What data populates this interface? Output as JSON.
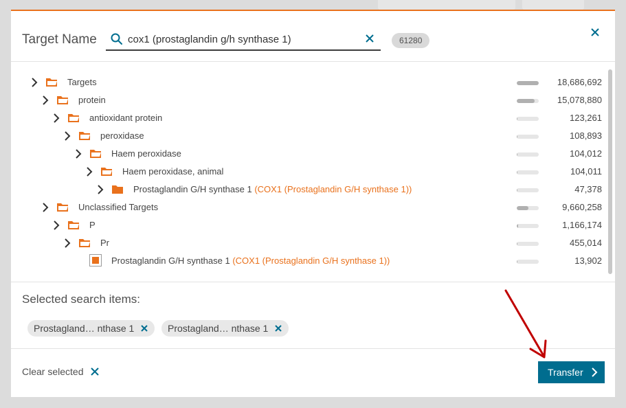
{
  "header": {
    "title": "Target Name",
    "search_value": "cox1 (prostaglandin g/h synthase 1)",
    "result_count": "61280",
    "close_icon": "close-icon",
    "search_icon": "search-icon",
    "clear_icon": "clear-search-icon"
  },
  "tree": {
    "rows": [
      {
        "label": "Targets",
        "synonym": "",
        "count": "18,686,692",
        "fraction": 1.0,
        "node": "folder-open",
        "expandable": true
      },
      {
        "label": "protein",
        "synonym": "",
        "count": "15,078,880",
        "fraction": 0.81,
        "node": "folder-open",
        "expandable": true
      },
      {
        "label": "antioxidant protein",
        "synonym": "",
        "count": "123,261",
        "fraction": 0.007,
        "node": "folder-open",
        "expandable": true
      },
      {
        "label": "peroxidase",
        "synonym": "",
        "count": "108,893",
        "fraction": 0.006,
        "node": "folder-open",
        "expandable": true
      },
      {
        "label": "Haem peroxidase",
        "synonym": "",
        "count": "104,012",
        "fraction": 0.006,
        "node": "folder-open",
        "expandable": true
      },
      {
        "label": "Haem peroxidase, animal",
        "synonym": "",
        "count": "104,011",
        "fraction": 0.006,
        "node": "folder-open",
        "expandable": true
      },
      {
        "label": "Prostaglandin G/H synthase 1 ",
        "synonym": "(COX1 (Prostaglandin G/H synthase 1))",
        "count": "47,378",
        "fraction": 0.003,
        "node": "folder-closed",
        "expandable": true
      },
      {
        "label": "Unclassified Targets",
        "synonym": "",
        "count": "9,660,258",
        "fraction": 0.52,
        "node": "folder-open",
        "expandable": true
      },
      {
        "label": "P",
        "synonym": "",
        "count": "1,166,174",
        "fraction": 0.06,
        "node": "folder-open",
        "expandable": true
      },
      {
        "label": "Pr",
        "synonym": "",
        "count": "455,014",
        "fraction": 0.025,
        "node": "folder-open",
        "expandable": true
      },
      {
        "label": "Prostaglandin G/H synthase 1 ",
        "synonym": "(COX1 (Prostaglandin G/H synthase 1))",
        "count": "13,902",
        "fraction": 0.001,
        "node": "checkbox-checked",
        "expandable": false
      }
    ]
  },
  "selected": {
    "title": "Selected search items:",
    "chips": [
      "Prostagland… nthase 1",
      "Prostagland… nthase 1"
    ]
  },
  "footer": {
    "clear_label": "Clear selected",
    "transfer_label": "Transfer"
  },
  "colors": {
    "accent": "#e9711c",
    "primary_button": "#006d8f",
    "annotation_arrow": "#c00000"
  }
}
